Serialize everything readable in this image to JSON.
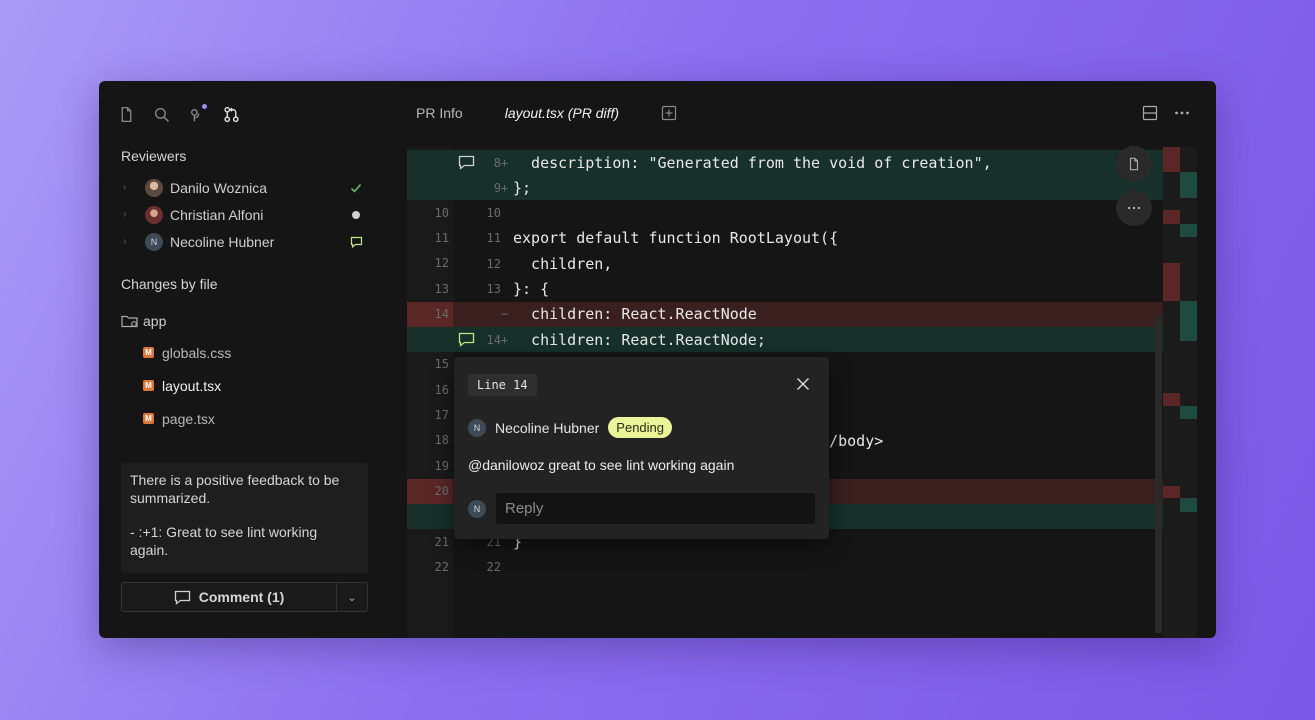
{
  "sidebar": {
    "toolbar": [
      "file-icon",
      "search-icon",
      "branch-icon",
      "pull-request-icon"
    ],
    "reviewers_title": "Reviewers",
    "reviewers": [
      {
        "name": "Danilo Woznica",
        "status": "approved",
        "status_color": "#6cc36a"
      },
      {
        "name": "Christian Alfoni",
        "status": "pending",
        "status_color": "#cfcfcf"
      },
      {
        "name": "Necoline Hubner",
        "initial": "N",
        "status": "commented",
        "status_color": "#c3e68a"
      }
    ],
    "changes_title": "Changes by file",
    "folder": "app",
    "files": [
      {
        "name": "globals.css",
        "badge": "M",
        "active": false
      },
      {
        "name": "layout.tsx",
        "badge": "M",
        "active": true
      },
      {
        "name": "page.tsx",
        "badge": "M",
        "active": false
      }
    ],
    "summary": {
      "p1": "There is a positive feedback to be summarized.",
      "p2": "- :+1: Great to see lint working again."
    },
    "comment_button": "Comment (1)"
  },
  "tabs": [
    {
      "label": "PR Info",
      "active": false
    },
    {
      "label": "layout.tsx (PR diff)",
      "active": true
    }
  ],
  "diff": [
    {
      "type": "add",
      "old": "",
      "new": "8",
      "sign": "+",
      "code": "  description: \"Generated from the void of creation\",",
      "comment_icon": true
    },
    {
      "type": "add",
      "old": "",
      "new": "9",
      "sign": "+",
      "code": "};"
    },
    {
      "type": "ctx",
      "old": "10",
      "new": "10",
      "sign": "",
      "code": ""
    },
    {
      "type": "ctx",
      "old": "11",
      "new": "11",
      "sign": "",
      "code": "export default function RootLayout({"
    },
    {
      "type": "ctx",
      "old": "12",
      "new": "12",
      "sign": "",
      "code": "  children,"
    },
    {
      "type": "ctx",
      "old": "13",
      "new": "13",
      "sign": "",
      "code": "}: {"
    },
    {
      "type": "del",
      "old": "14",
      "new": "",
      "sign": "−",
      "code": "  children: React.ReactNode"
    },
    {
      "type": "add",
      "old": "",
      "new": "14",
      "sign": "+",
      "code": "  children: React.ReactNode;",
      "comment_icon": true,
      "comment_active": true
    },
    {
      "type": "ctx",
      "old": "15",
      "new": "",
      "sign": "",
      "code": ""
    },
    {
      "type": "ctx",
      "old": "16",
      "new": "",
      "sign": "",
      "code": ""
    },
    {
      "type": "ctx",
      "old": "17",
      "new": "",
      "sign": "",
      "code": ""
    },
    {
      "type": "ctx",
      "old": "18",
      "new": "",
      "sign": "",
      "code": "                  Name}>{children}</body>"
    },
    {
      "type": "ctx",
      "old": "19",
      "new": "",
      "sign": "",
      "code": ""
    },
    {
      "type": "del",
      "old": "20",
      "new": "",
      "sign": "",
      "code": ""
    },
    {
      "type": "add",
      "old": "",
      "new": "",
      "sign": "",
      "code": ""
    },
    {
      "type": "ctx",
      "old": "21",
      "new": "21",
      "sign": "",
      "code": "}"
    },
    {
      "type": "ctx",
      "old": "22",
      "new": "22",
      "sign": "",
      "code": ""
    }
  ],
  "popup": {
    "line_label": "Line 14",
    "author": "Necoline Hubner",
    "author_initial": "N",
    "status": "Pending",
    "text": "@danilowoz great to see lint working again",
    "reply_placeholder": "Reply",
    "reply_initial": "N"
  },
  "colors": {
    "add_bg": "#17302a",
    "del_bg": "#3a1f1f",
    "pending_badge": "#eaf59a",
    "accent": "#a78bfa"
  }
}
